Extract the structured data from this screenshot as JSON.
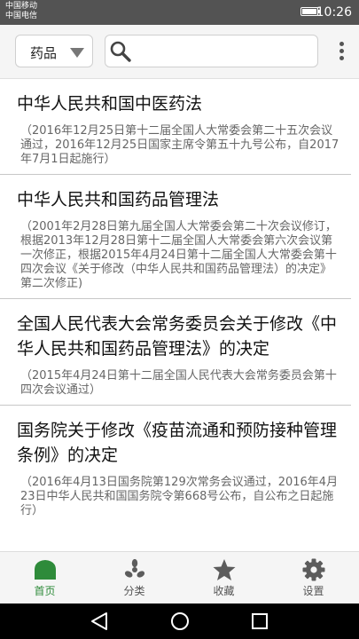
{
  "status_bar": {
    "carrier_1": "中国移动",
    "carrier_2": "中国电信",
    "time": "10:26"
  },
  "header": {
    "category_selected": "药品",
    "search_placeholder": "",
    "search_value": ""
  },
  "laws": [
    {
      "title": "中华人民共和国中医药法",
      "desc": "（2016年12月25日第十二届全国人大常委会第二十五次会议通过，2016年12月25日国家主席令第五十九号公布，自2017年7月1日起施行）"
    },
    {
      "title": "中华人民共和国药品管理法",
      "desc": "（2001年2月28日第九届全国人大常委会第二十次会议修订，根据2013年12月28日第十二届全国人大常委会第六次会议第一次修正，根据2015年4月24日第十二届全国人大常委会第十四次会议《关于修改（中华人民共和国药品管理法）的决定》第二次修正)"
    },
    {
      "title": "全国人民代表大会常务委员会关于修改《中华人民共和国药品管理法》的决定",
      "desc": "（2015年4月24日第十二届全国人民代表大会常务委员会第十四次会议通过）"
    },
    {
      "title": "国务院关于修改《疫苗流通和预防接种管理条例》的决定",
      "desc": "（2016年4月13日国务院第129次常务会议通过，2016年4月23日中华人民共和国国务院令第668号公布，自公布之日起施行）"
    }
  ],
  "bottom_nav": {
    "home": "首页",
    "category": "分类",
    "favorites": "收藏",
    "settings": "设置"
  },
  "colors": {
    "accent": "#2e8b3a",
    "icon_gray": "#5c5c5c"
  },
  "icons": {
    "home": "home-icon",
    "category": "pinwheel-icon",
    "favorites": "star-icon",
    "settings": "gear-icon",
    "search": "search-icon",
    "more": "more-vertical-icon"
  }
}
